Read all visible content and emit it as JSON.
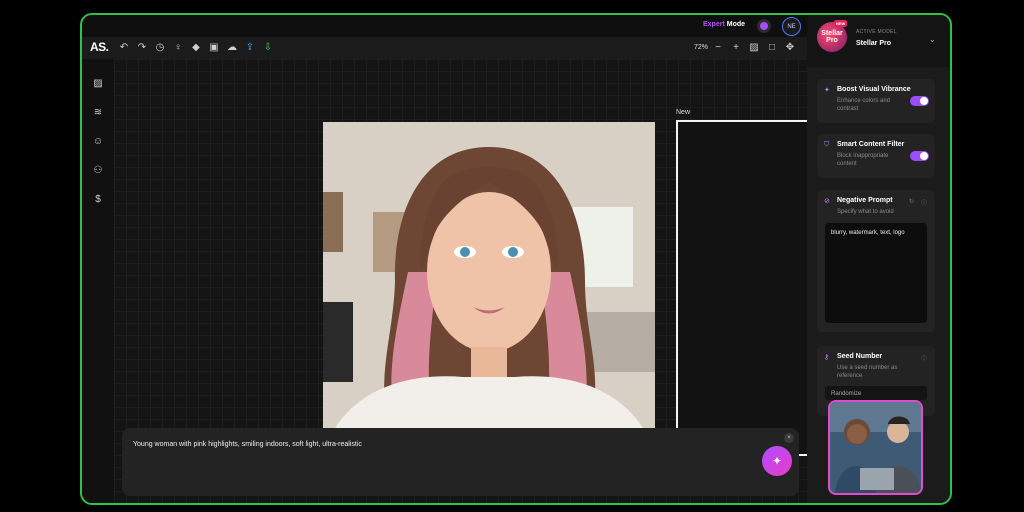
{
  "app": {
    "logo_text": "AS."
  },
  "header": {
    "expert_word": "Expert",
    "mode_word": "Mode",
    "avatar_initials": "NE"
  },
  "toolbar": {
    "zoom": "72%"
  },
  "canvas": {
    "new_label": "New"
  },
  "prompt": {
    "text": "Young woman with pink highlights, smiling indoors, soft light, ultra-realistic"
  },
  "model": {
    "badge": "NEW",
    "logo_text": "Stellar Pro",
    "active_label": "ACTIVE MODEL",
    "name": "Stellar Pro"
  },
  "settings": {
    "boost": {
      "title": "Boost Visual Vibrance",
      "desc": "Enhance colors and contrast",
      "enabled": true
    },
    "filter": {
      "title": "Smart Content Filter",
      "desc": "Block inappropriate content",
      "enabled": true
    },
    "negative": {
      "title": "Negative Prompt",
      "desc": "Specify what to avoid",
      "value": "blurry, watermark, text, logo"
    },
    "seed": {
      "title": "Seed Number",
      "desc": "Use a seed number as reference",
      "button": "Randomize"
    }
  },
  "colors": {
    "frame_border": "#2fc24a",
    "accent": "#9b4dff",
    "video_border": "#e04bd0"
  }
}
